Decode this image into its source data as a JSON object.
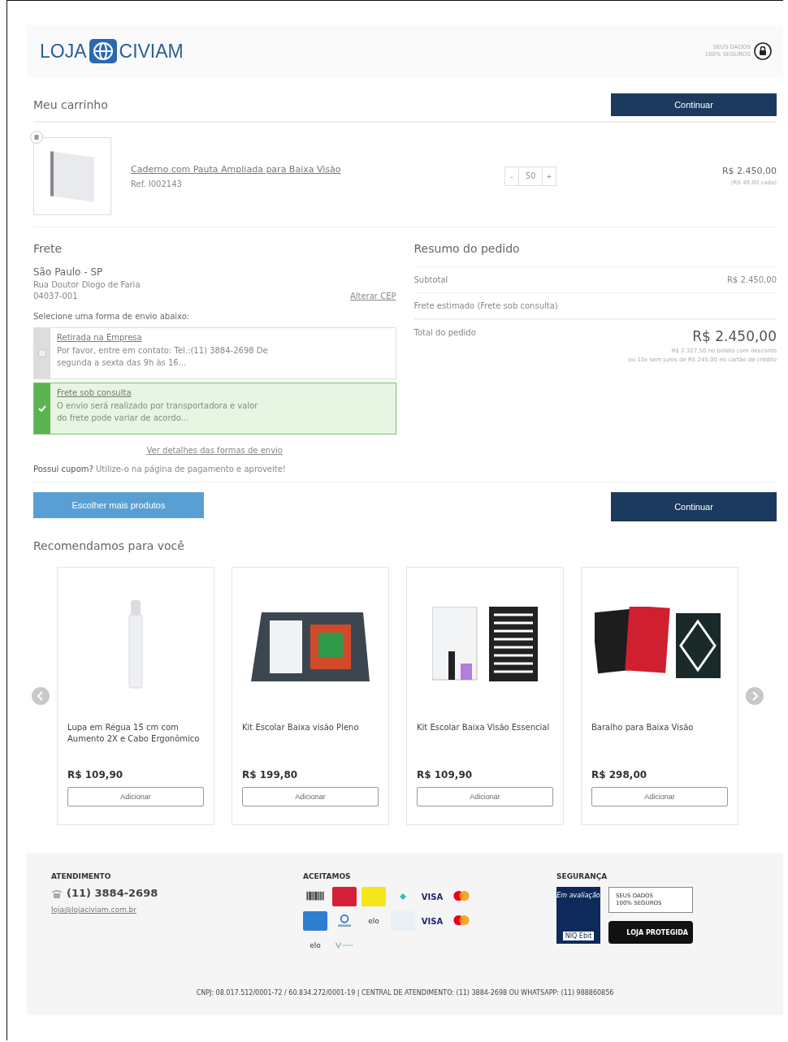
{
  "header": {
    "logo_left": "LOJA",
    "logo_right": "CIVIAM",
    "secure_badge": [
      "SEUS DADOS",
      "100% SEGUROS"
    ]
  },
  "cart": {
    "title": "Meu carrinho",
    "continue_button": "Continuar",
    "items": [
      {
        "name": "Caderno com Pauta Ampliada para Baixa Visão",
        "ref": "Ref. I002143",
        "quantity": "50",
        "minus": "-",
        "plus": "+",
        "total": "R$ 2.450,00",
        "unit_price": "(R$ 49,00 cada)"
      }
    ]
  },
  "shipping": {
    "title": "Frete",
    "city": "São Paulo - SP",
    "street": "Rua Doutor Diogo de Faria",
    "cep": "04037-001",
    "change_cep": "Alterar CEP",
    "prompt": "Selecione uma forma de envio abaixo:",
    "options": [
      {
        "name": "Retirada na Empresa",
        "description": "Por favor, entre em contato: Tel.:(11) 3884-2698 De segunda a sexta das 9h às 16...",
        "selected": false
      },
      {
        "name": "Frete sob consulta",
        "description": "O envio será realizado por transportadora e valor do frete pode variar de acordo...",
        "selected": true
      }
    ],
    "details_link": "Ver detalhes das formas de envio",
    "coupon_bold": "Possui cupom?",
    "coupon_text": "Utilize-o na página de pagamento e aproveite!"
  },
  "summary": {
    "title": "Resumo do pedido",
    "subtotal_label": "Subtotal",
    "subtotal": "R$ 2.450,00",
    "shipping_label": "Frete estimado (Frete sob consulta)",
    "total_label": "Total do pedido",
    "total": "R$ 2.450,00",
    "boleto_note": "R$ 2.327,50 no boleto com desconto",
    "card_note": "ou 10x sem juros de R$ 245,00 no cartão de crédito"
  },
  "actions": {
    "more_products": "Escolher mais produtos",
    "continue_button": "Continuar"
  },
  "recommendations": {
    "title": "Recomendamos para você",
    "products": [
      {
        "kind": "ruler",
        "name": "Lupa em Régua 15 cm com Aumento 2X e Cabo Ergonômico",
        "price": "R$ 109,90",
        "button": "Adicionar"
      },
      {
        "kind": "kit",
        "name": "Kit Escolar Baixa visão Pleno",
        "price": "R$ 199,80",
        "button": "Adicionar"
      },
      {
        "kind": "notebook",
        "name": "Kit Escolar Baixa Visão Essencial",
        "price": "R$ 109,90",
        "button": "Adicionar"
      },
      {
        "kind": "cards",
        "name": "Baralho para Baixa Visão",
        "price": "R$ 298,00",
        "button": "Adicionar"
      }
    ]
  },
  "footer": {
    "support_title": "ATENDIMENTO",
    "phone": "(11) 3884-2698",
    "email": "loja@lojaciviam.com.br",
    "payments_title": "ACEITAMOS",
    "payments": [
      {
        "kind": "boleto"
      },
      {
        "kind": "tile",
        "color": "#d5203a"
      },
      {
        "kind": "tile",
        "color": "#f5e61c"
      },
      {
        "kind": "pix"
      },
      {
        "kind": "visa",
        "label": "VISA"
      },
      {
        "kind": "mastercard"
      },
      {
        "kind": "tile",
        "color": "#2e7fd0"
      },
      {
        "kind": "hipercard"
      },
      {
        "kind": "elo",
        "label": "elo"
      },
      {
        "kind": "tile",
        "color": "#e8f0f6"
      },
      {
        "kind": "visa",
        "label": "VISA"
      },
      {
        "kind": "mastercard"
      },
      {
        "kind": "elo",
        "label": "elo"
      },
      {
        "kind": "vale"
      }
    ],
    "security_title": "SEGURANÇA",
    "ebit": {
      "top": "Em avaliação",
      "brand": "NIQ Ebit"
    },
    "secure_badge": [
      "SEUS DADOS",
      "100% SEGUROS"
    ],
    "protected_badge": "LOJA PROTEGIDA",
    "legal": "CNPJ: 08.017.512/0001-72 / 60.834.272/0001-19 | CENTRAL DE ATENDIMENTO: (11) 3884-2698 OU WHATSAPP: (11) 988860856"
  }
}
